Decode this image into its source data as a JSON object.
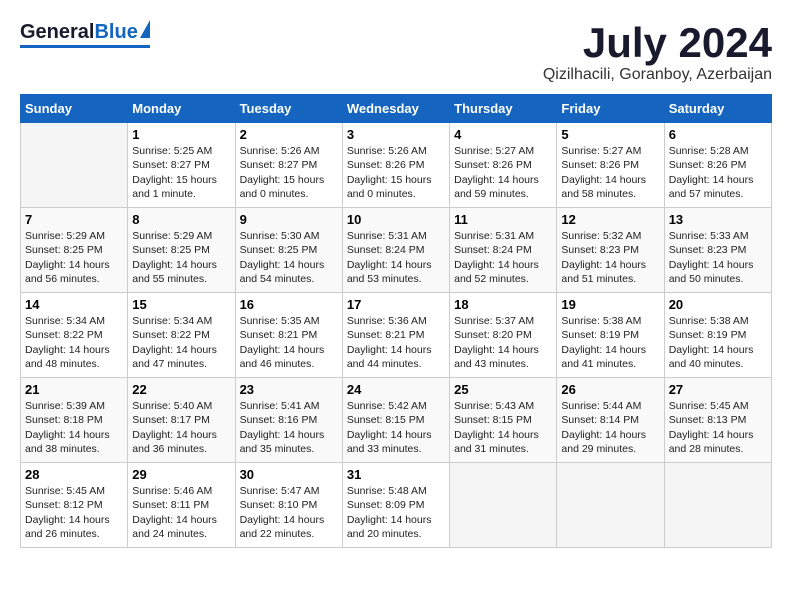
{
  "header": {
    "logo_general": "General",
    "logo_blue": "Blue",
    "title": "July 2024",
    "location": "Qizilhacili, Goranboy, Azerbaijan"
  },
  "days_of_week": [
    "Sunday",
    "Monday",
    "Tuesday",
    "Wednesday",
    "Thursday",
    "Friday",
    "Saturday"
  ],
  "weeks": [
    [
      {
        "num": "",
        "info": ""
      },
      {
        "num": "1",
        "info": "Sunrise: 5:25 AM\nSunset: 8:27 PM\nDaylight: 15 hours\nand 1 minute."
      },
      {
        "num": "2",
        "info": "Sunrise: 5:26 AM\nSunset: 8:27 PM\nDaylight: 15 hours\nand 0 minutes."
      },
      {
        "num": "3",
        "info": "Sunrise: 5:26 AM\nSunset: 8:26 PM\nDaylight: 15 hours\nand 0 minutes."
      },
      {
        "num": "4",
        "info": "Sunrise: 5:27 AM\nSunset: 8:26 PM\nDaylight: 14 hours\nand 59 minutes."
      },
      {
        "num": "5",
        "info": "Sunrise: 5:27 AM\nSunset: 8:26 PM\nDaylight: 14 hours\nand 58 minutes."
      },
      {
        "num": "6",
        "info": "Sunrise: 5:28 AM\nSunset: 8:26 PM\nDaylight: 14 hours\nand 57 minutes."
      }
    ],
    [
      {
        "num": "7",
        "info": "Sunrise: 5:29 AM\nSunset: 8:25 PM\nDaylight: 14 hours\nand 56 minutes."
      },
      {
        "num": "8",
        "info": "Sunrise: 5:29 AM\nSunset: 8:25 PM\nDaylight: 14 hours\nand 55 minutes."
      },
      {
        "num": "9",
        "info": "Sunrise: 5:30 AM\nSunset: 8:25 PM\nDaylight: 14 hours\nand 54 minutes."
      },
      {
        "num": "10",
        "info": "Sunrise: 5:31 AM\nSunset: 8:24 PM\nDaylight: 14 hours\nand 53 minutes."
      },
      {
        "num": "11",
        "info": "Sunrise: 5:31 AM\nSunset: 8:24 PM\nDaylight: 14 hours\nand 52 minutes."
      },
      {
        "num": "12",
        "info": "Sunrise: 5:32 AM\nSunset: 8:23 PM\nDaylight: 14 hours\nand 51 minutes."
      },
      {
        "num": "13",
        "info": "Sunrise: 5:33 AM\nSunset: 8:23 PM\nDaylight: 14 hours\nand 50 minutes."
      }
    ],
    [
      {
        "num": "14",
        "info": "Sunrise: 5:34 AM\nSunset: 8:22 PM\nDaylight: 14 hours\nand 48 minutes."
      },
      {
        "num": "15",
        "info": "Sunrise: 5:34 AM\nSunset: 8:22 PM\nDaylight: 14 hours\nand 47 minutes."
      },
      {
        "num": "16",
        "info": "Sunrise: 5:35 AM\nSunset: 8:21 PM\nDaylight: 14 hours\nand 46 minutes."
      },
      {
        "num": "17",
        "info": "Sunrise: 5:36 AM\nSunset: 8:21 PM\nDaylight: 14 hours\nand 44 minutes."
      },
      {
        "num": "18",
        "info": "Sunrise: 5:37 AM\nSunset: 8:20 PM\nDaylight: 14 hours\nand 43 minutes."
      },
      {
        "num": "19",
        "info": "Sunrise: 5:38 AM\nSunset: 8:19 PM\nDaylight: 14 hours\nand 41 minutes."
      },
      {
        "num": "20",
        "info": "Sunrise: 5:38 AM\nSunset: 8:19 PM\nDaylight: 14 hours\nand 40 minutes."
      }
    ],
    [
      {
        "num": "21",
        "info": "Sunrise: 5:39 AM\nSunset: 8:18 PM\nDaylight: 14 hours\nand 38 minutes."
      },
      {
        "num": "22",
        "info": "Sunrise: 5:40 AM\nSunset: 8:17 PM\nDaylight: 14 hours\nand 36 minutes."
      },
      {
        "num": "23",
        "info": "Sunrise: 5:41 AM\nSunset: 8:16 PM\nDaylight: 14 hours\nand 35 minutes."
      },
      {
        "num": "24",
        "info": "Sunrise: 5:42 AM\nSunset: 8:15 PM\nDaylight: 14 hours\nand 33 minutes."
      },
      {
        "num": "25",
        "info": "Sunrise: 5:43 AM\nSunset: 8:15 PM\nDaylight: 14 hours\nand 31 minutes."
      },
      {
        "num": "26",
        "info": "Sunrise: 5:44 AM\nSunset: 8:14 PM\nDaylight: 14 hours\nand 29 minutes."
      },
      {
        "num": "27",
        "info": "Sunrise: 5:45 AM\nSunset: 8:13 PM\nDaylight: 14 hours\nand 28 minutes."
      }
    ],
    [
      {
        "num": "28",
        "info": "Sunrise: 5:45 AM\nSunset: 8:12 PM\nDaylight: 14 hours\nand 26 minutes."
      },
      {
        "num": "29",
        "info": "Sunrise: 5:46 AM\nSunset: 8:11 PM\nDaylight: 14 hours\nand 24 minutes."
      },
      {
        "num": "30",
        "info": "Sunrise: 5:47 AM\nSunset: 8:10 PM\nDaylight: 14 hours\nand 22 minutes."
      },
      {
        "num": "31",
        "info": "Sunrise: 5:48 AM\nSunset: 8:09 PM\nDaylight: 14 hours\nand 20 minutes."
      },
      {
        "num": "",
        "info": ""
      },
      {
        "num": "",
        "info": ""
      },
      {
        "num": "",
        "info": ""
      }
    ]
  ]
}
